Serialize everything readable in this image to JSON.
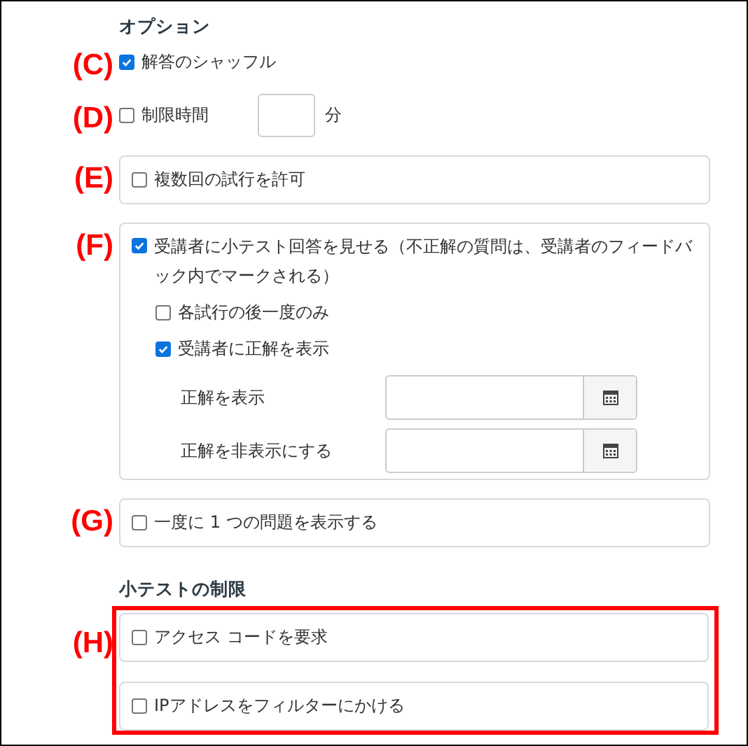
{
  "options": {
    "heading": "オプション",
    "rows": [
      {
        "marker": "(C)",
        "kind": "plain",
        "label": "解答のシャッフル",
        "checked": true
      },
      {
        "marker": "(D)",
        "kind": "time",
        "label": "制限時間",
        "checked": false,
        "unit": "分"
      },
      {
        "marker": "(E)",
        "kind": "boxed",
        "label": "複数回の試行を許可",
        "checked": false
      },
      {
        "marker": "(F)",
        "kind": "panel",
        "label": "受講者に小テスト回答を見せる（不正解の質問は、受講者のフィードバック内でマークされる）",
        "checked": true,
        "sub_options": [
          {
            "label": "各試行の後一度のみ",
            "checked": false
          },
          {
            "label": "受講者に正解を表示",
            "checked": true
          }
        ],
        "date_fields": [
          {
            "label": "正解を表示"
          },
          {
            "label": "正解を非表示にする"
          }
        ]
      },
      {
        "marker": "(G)",
        "kind": "boxed",
        "label": "一度に 1 つの問題を表示する",
        "checked": false
      }
    ]
  },
  "restrictions": {
    "heading": "小テストの制限",
    "marker": "(H)",
    "highlighted": true,
    "items": [
      {
        "label": "アクセス コードを要求",
        "checked": false
      },
      {
        "label": "IPアドレスをフィルターにかける",
        "checked": false
      }
    ]
  }
}
